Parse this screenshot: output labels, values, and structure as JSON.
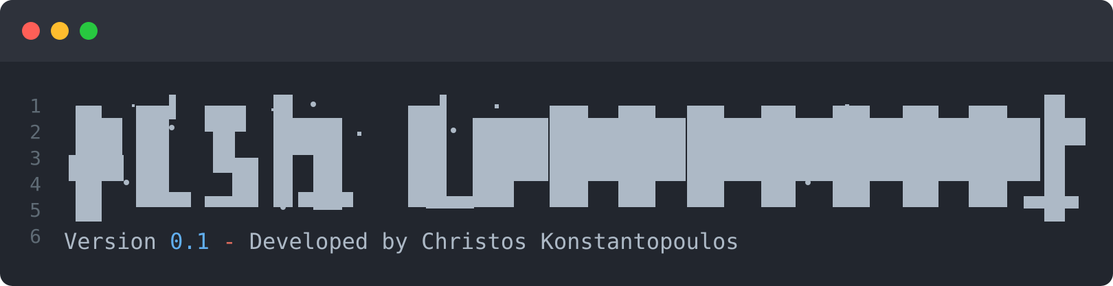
{
  "window": {
    "controls": [
      {
        "name": "close",
        "color": "#ff5f57"
      },
      {
        "name": "minimize",
        "color": "#ffbd2e"
      },
      {
        "name": "zoom",
        "color": "#28c840"
      }
    ]
  },
  "editor": {
    "line_numbers": [
      "1",
      "2",
      "3",
      "4",
      "5",
      "6"
    ],
    "banner": {
      "description": "ASCII-art block banner rendered as blocky glyphs",
      "color": "#adb9c6"
    },
    "version_line": {
      "prefix": "Version ",
      "version": "0.1",
      "dash": " - ",
      "suffix": "Developed by Christos Konstantopoulos"
    },
    "colors": {
      "background": "#22262e",
      "titlebar": "#2e323b",
      "text": "#adb9c6",
      "accent": "#61aff0",
      "dash": "#e06c5d",
      "gutter": "#5f6b75"
    }
  }
}
